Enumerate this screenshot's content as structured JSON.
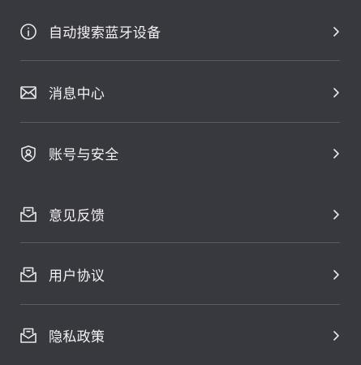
{
  "menu": {
    "items": [
      {
        "label": "自动搜索蓝牙设备",
        "icon": "info-circle-icon"
      },
      {
        "label": "消息中心",
        "icon": "envelope-icon"
      },
      {
        "label": "账号与安全",
        "icon": "shield-user-icon"
      },
      {
        "label": "意见反馈",
        "icon": "open-envelope-icon"
      },
      {
        "label": "用户协议",
        "icon": "open-envelope-icon"
      },
      {
        "label": "隐私政策",
        "icon": "open-envelope-icon"
      }
    ]
  },
  "colors": {
    "background": "#38383f",
    "text": "#f2f2f4",
    "divider": "#5a5a62",
    "icon": "#e8e8ea"
  }
}
